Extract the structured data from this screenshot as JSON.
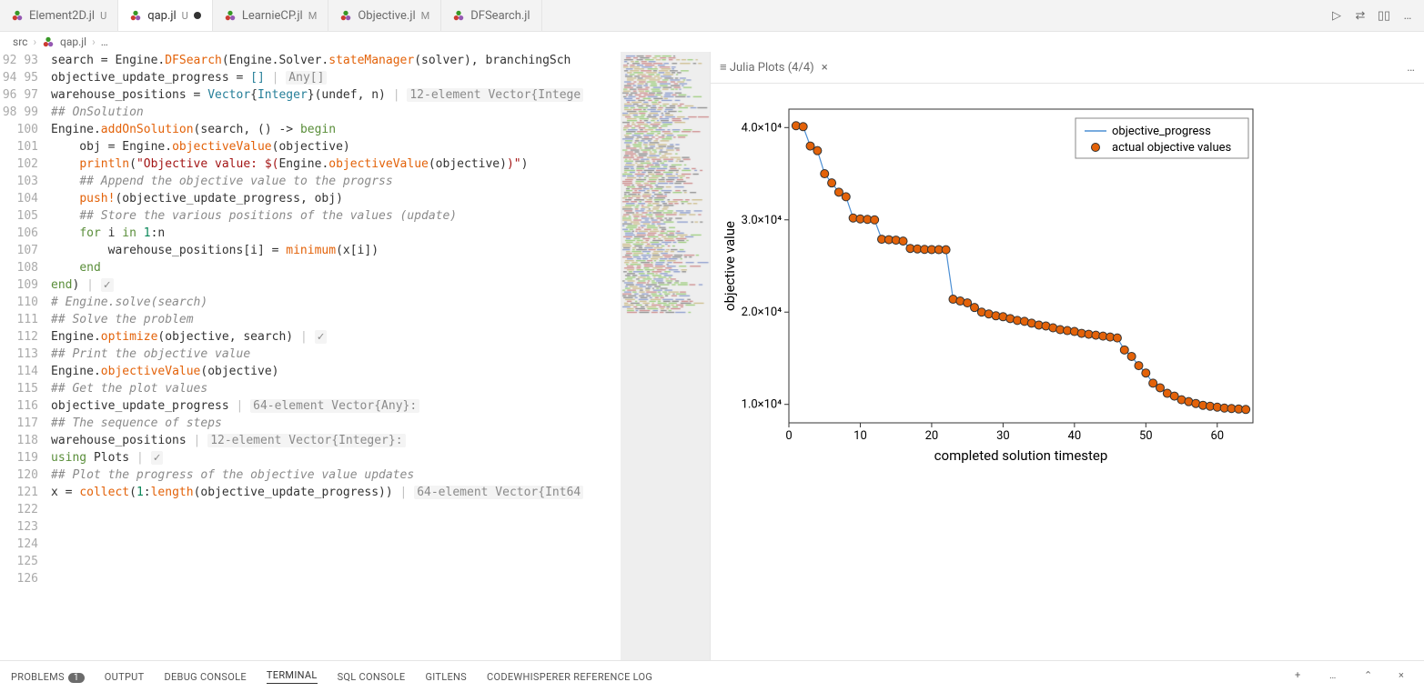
{
  "tabs": [
    {
      "label": "Element2D.jl",
      "status": "U"
    },
    {
      "label": "qap.jl",
      "status": "U",
      "modified": true,
      "active": true
    },
    {
      "label": "LearnieCP.jl",
      "status": "M"
    },
    {
      "label": "Objective.jl",
      "status": "M"
    },
    {
      "label": "DFSearch.jl",
      "status": ""
    }
  ],
  "tabs_actions": {
    "run": "▷",
    "compare": "⇄",
    "split": "▯▯",
    "more": "…"
  },
  "breadcrumbs": [
    "src",
    "qap.jl",
    "…"
  ],
  "line_start": 92,
  "line_end": 126,
  "hints": {
    "l94": "Any[]",
    "l97": "",
    "l106": "✓",
    "l110": "✓",
    "l116": "64-element Vector{Any}:",
    "l119": "12-element Vector{Integer}:",
    "l122": "✓",
    "l125": "64-element Vector{Int64",
    "l95": "12-element Vector{Intege"
  },
  "code_text": {
    "l92": "search = Engine.DFSearch(Engine.Solver.stateManager(solver), branchingSch",
    "l94": "objective_update_progress = [] ",
    "l95": "warehouse_positions = Vector{Integer}(undef, n) ",
    "l96": "## OnSolution",
    "l97": "Engine.addOnSolution(search, () -> begin",
    "l98": "    obj = Engine.objectiveValue(objective)",
    "l99": "    println(\"Objective value: $(Engine.objectiveValue(objective))\")",
    "l100": "    ## Append the objective value to the progrss",
    "l101": "    push!(objective_update_progress, obj)",
    "l102": "    ## Store the various positions of the values (update)",
    "l103": "    for i in 1:n",
    "l104": "        warehouse_positions[i] = minimum(x[i])",
    "l105": "    end",
    "l106": "end) ",
    "l108": "# Engine.solve(search)",
    "l109": "## Solve the problem",
    "l110": "Engine.optimize(objective, search) ",
    "l112": "## Print the objective value",
    "l113": "Engine.objectiveValue(objective)",
    "l115": "## Get the plot values",
    "l116": "objective_update_progress ",
    "l118": "## The sequence of steps",
    "l119": "warehouse_positions ",
    "l122": "using Plots ",
    "l124": "## Plot the progress of the objective value updates",
    "l125": "x = collect(1:length(objective_update_progress)) "
  },
  "side_panel": {
    "title": "Julia Plots (4/4)",
    "close": "×",
    "more": "…"
  },
  "chart_data": {
    "type": "scatter",
    "xlabel": "completed solution timestep",
    "ylabel": "objective value",
    "legend": [
      "objective_progress",
      "actual objective values"
    ],
    "x_ticks": [
      0,
      10,
      20,
      30,
      40,
      50,
      60
    ],
    "y_ticks": [
      10000,
      20000,
      30000,
      40000
    ],
    "y_tick_labels": [
      "1.0×10⁴",
      "2.0×10⁴",
      "3.0×10⁴",
      "4.0×10⁴"
    ],
    "xlim": [
      0,
      65
    ],
    "ylim": [
      8000,
      42000
    ],
    "x": [
      1,
      2,
      3,
      4,
      5,
      6,
      7,
      8,
      9,
      10,
      11,
      12,
      13,
      14,
      15,
      16,
      17,
      18,
      19,
      20,
      21,
      22,
      23,
      24,
      25,
      26,
      27,
      28,
      29,
      30,
      31,
      32,
      33,
      34,
      35,
      36,
      37,
      38,
      39,
      40,
      41,
      42,
      43,
      44,
      45,
      46,
      47,
      48,
      49,
      50,
      51,
      52,
      53,
      54,
      55,
      56,
      57,
      58,
      59,
      60,
      61,
      62,
      63,
      64
    ],
    "y": [
      40200,
      40100,
      38000,
      37500,
      35000,
      34000,
      33000,
      32500,
      30200,
      30100,
      30050,
      30000,
      27900,
      27850,
      27800,
      27700,
      26900,
      26850,
      26800,
      26780,
      26770,
      26760,
      21400,
      21200,
      21000,
      20500,
      20000,
      19800,
      19600,
      19500,
      19300,
      19100,
      19000,
      18800,
      18600,
      18500,
      18300,
      18100,
      18000,
      17900,
      17700,
      17600,
      17500,
      17400,
      17300,
      17200,
      15900,
      15200,
      14200,
      13400,
      12300,
      11800,
      11200,
      10900,
      10500,
      10300,
      10100,
      9900,
      9800,
      9700,
      9600,
      9550,
      9500,
      9450
    ],
    "marker_fill": "#e36209",
    "marker_stroke": "#333",
    "line_color": "#4c8fd4"
  },
  "panels": {
    "items": [
      {
        "label": "PROBLEMS",
        "badge": "1"
      },
      {
        "label": "OUTPUT"
      },
      {
        "label": "DEBUG CONSOLE"
      },
      {
        "label": "TERMINAL",
        "active": true
      },
      {
        "label": "SQL CONSOLE"
      },
      {
        "label": "GITLENS"
      },
      {
        "label": "CODEWHISPERER REFERENCE LOG"
      }
    ],
    "right": {
      "add": "+",
      "more": "…",
      "up": "⌃",
      "close": "×"
    }
  }
}
